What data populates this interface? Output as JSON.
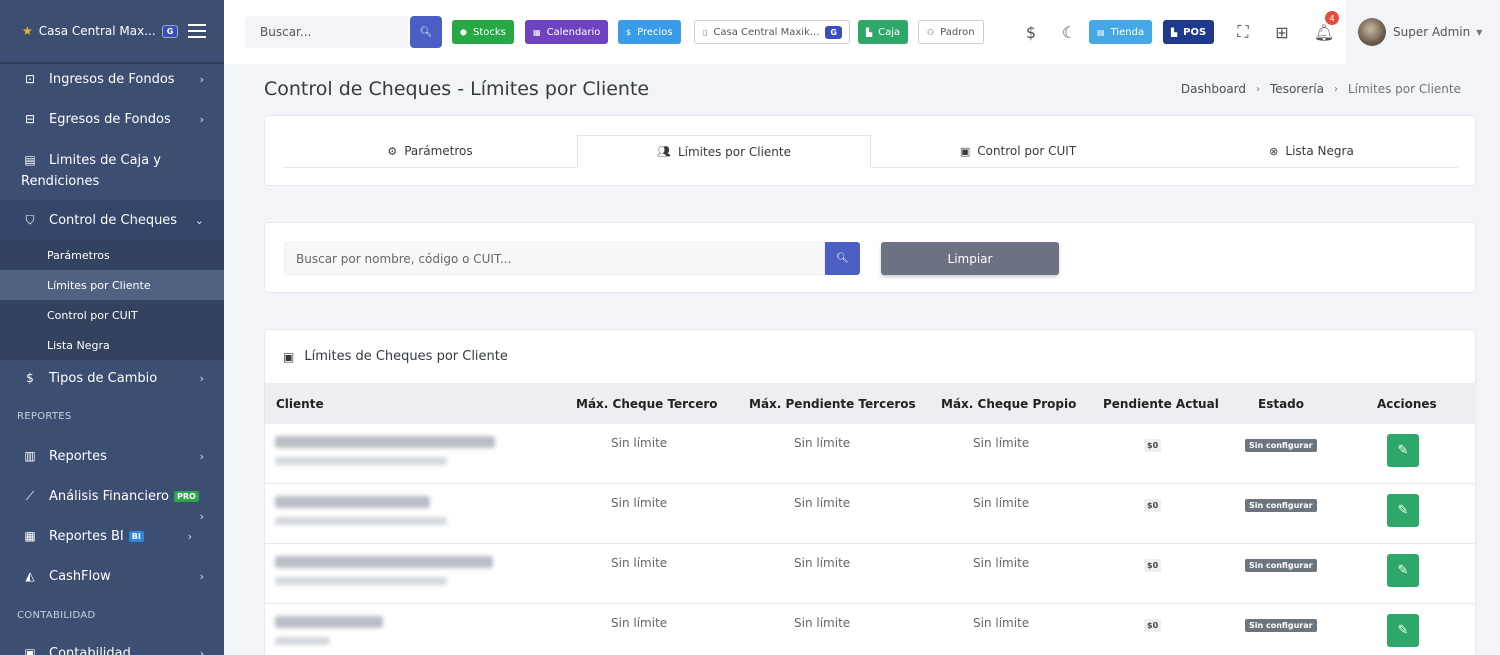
{
  "sidebar": {
    "brand": "Casa Central Max...",
    "brand_badge": "G",
    "items": [
      {
        "label": "Ingresos de Fondos",
        "icon": "money-in-icon"
      },
      {
        "label": "Egresos de Fondos",
        "icon": "money-out-icon"
      },
      {
        "label": "Limites de Caja y",
        "label2": "Rendiciones",
        "icon": "cash-limit-icon"
      },
      {
        "label": "Control de Cheques",
        "icon": "shield-check-icon"
      }
    ],
    "subitems": [
      "Parámetros",
      "Límites por Cliente",
      "Control por CUIT",
      "Lista Negra"
    ],
    "tipos_cambio": "Tipos de Cambio",
    "section_reportes": "REPORTES",
    "reportes": "Reportes",
    "analisis": "Análisis Financiero",
    "analisis_badge": "PRO",
    "reportes_bi": "Reportes BI",
    "bi_badge": "BI",
    "cashflow": "CashFlow",
    "section_contabilidad": "CONTABILIDAD",
    "contabilidad": "Contabilidad"
  },
  "topbar": {
    "search_placeholder": "Buscar...",
    "stocks": "Stocks",
    "calendario": "Calendario",
    "precios": "Precios",
    "branch": "Casa Central Maxik...",
    "branch_badge": "G",
    "caja": "Caja",
    "padron": "Padron",
    "tienda": "Tienda",
    "pos": "POS",
    "notif_count": "4",
    "user": "Super Admin",
    "colors": {
      "stocks": "#28a745",
      "calendario": "#6f42c1",
      "precios": "#3a9be8",
      "caja": "#2ea86a",
      "tienda": "#47a8e8",
      "pos": "#1f3a8c"
    }
  },
  "page": {
    "title": "Control de Cheques - Límites por Cliente",
    "breadcrumb": [
      "Dashboard",
      "Tesorería",
      "Límites por Cliente"
    ]
  },
  "tabs": [
    "Parámetros",
    "Límites por Cliente",
    "Control por CUIT",
    "Lista Negra"
  ],
  "search": {
    "placeholder": "Buscar por nombre, código o CUIT...",
    "clear": "Limpiar"
  },
  "table": {
    "title": "Límites de Cheques por Cliente",
    "headers": [
      "Cliente",
      "Máx. Cheque Tercero",
      "Máx. Pendiente Terceros",
      "Máx. Cheque Propio",
      "Pendiente Actual",
      "Estado",
      "Acciones"
    ],
    "rows": [
      {
        "max_tercero": "Sin límite",
        "max_pendiente": "Sin límite",
        "max_propio": "Sin límite",
        "pendiente": "$0",
        "estado": "Sin configurar"
      },
      {
        "max_tercero": "Sin límite",
        "max_pendiente": "Sin límite",
        "max_propio": "Sin límite",
        "pendiente": "$0",
        "estado": "Sin configurar"
      },
      {
        "max_tercero": "Sin límite",
        "max_pendiente": "Sin límite",
        "max_propio": "Sin límite",
        "pendiente": "$0",
        "estado": "Sin configurar"
      },
      {
        "max_tercero": "Sin límite",
        "max_pendiente": "Sin límite",
        "max_propio": "Sin límite",
        "pendiente": "$0",
        "estado": "Sin configurar"
      }
    ]
  }
}
